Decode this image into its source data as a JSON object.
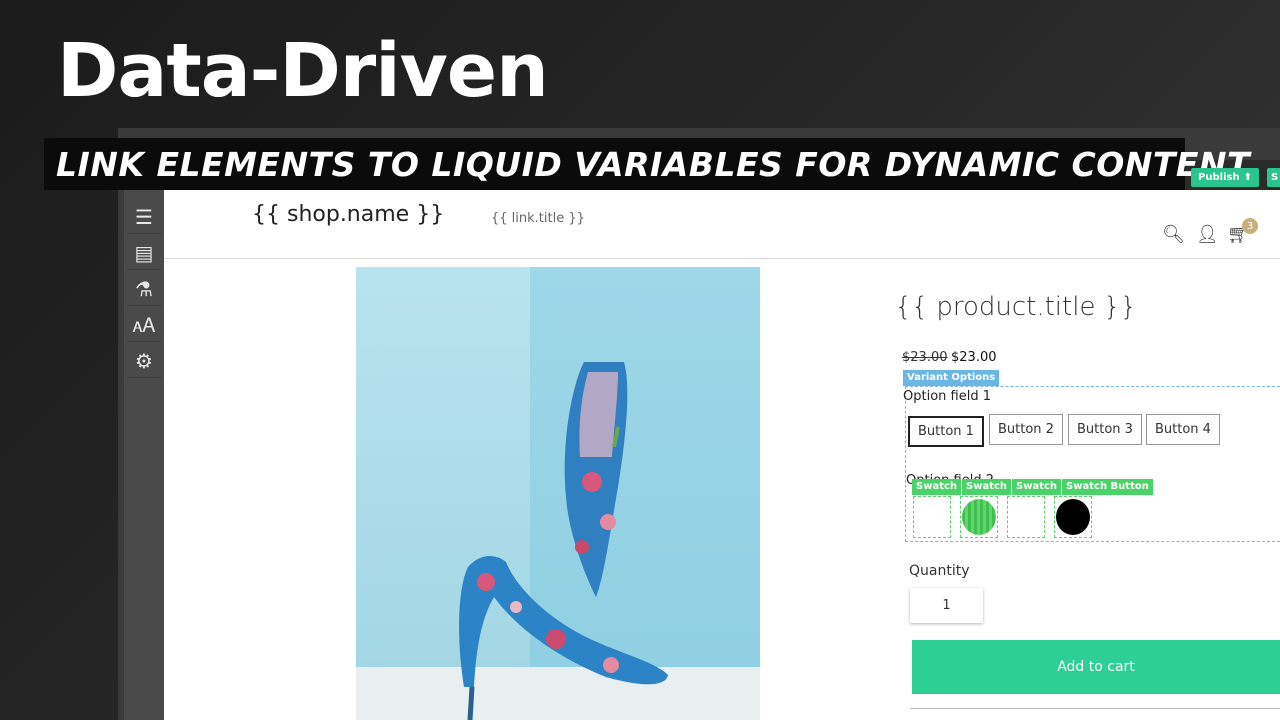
{
  "overlay": {
    "headline": "Data-Driven",
    "subheadline": "LINK ELEMENTS TO LIQUID VARIABLES FOR DYNAMIC CONTENT"
  },
  "editor": {
    "publish_label": "Publish",
    "save_label": "S",
    "sidebar_icons": [
      "menu-icon",
      "page-icon",
      "flask-icon",
      "translate-icon",
      "settings-icon"
    ]
  },
  "store": {
    "shop_name": "{{ shop.name }}",
    "link_title": "{{ link.title }}",
    "cart_count": "3"
  },
  "product": {
    "title": "{{ product.title }}",
    "compare_price": "$23.00",
    "price": "$23.00",
    "variant_tag": "Variant Options",
    "option1_label": "Option field 1",
    "option1_buttons": [
      "Button 1",
      "Button 2",
      "Button 3",
      "Button 4"
    ],
    "option2_label": "Option field 2",
    "swatch_tags": [
      "Swatch",
      "Swatch",
      "Swatch",
      "Swatch Button"
    ],
    "quantity_label": "Quantity",
    "quantity_value": "1",
    "add_to_cart": "Add to cart"
  }
}
